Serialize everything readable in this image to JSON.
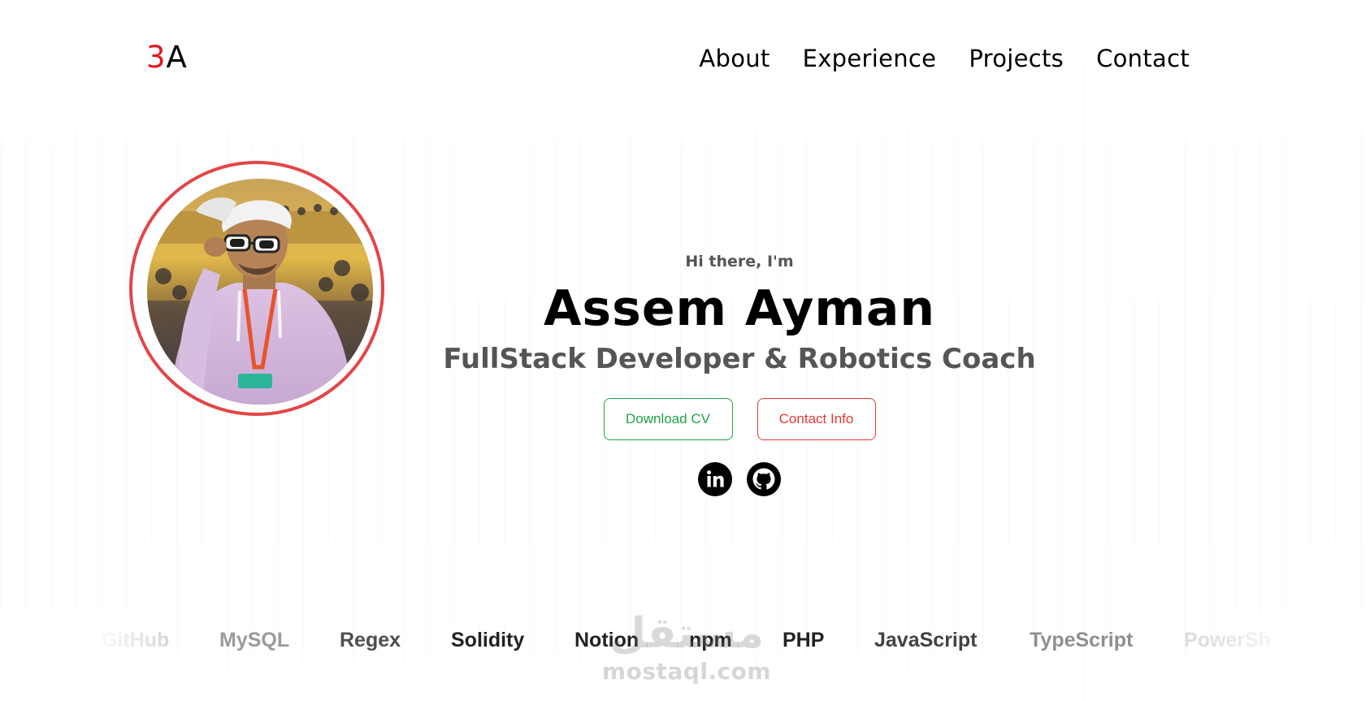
{
  "logo": {
    "accent": "3",
    "rest": "A"
  },
  "nav": {
    "items": [
      {
        "label": "About"
      },
      {
        "label": "Experience"
      },
      {
        "label": "Projects"
      },
      {
        "label": "Contact"
      }
    ]
  },
  "hero": {
    "greeting": "Hi there, I'm",
    "name": "Assem Ayman",
    "role": "FullStack Developer & Robotics Coach",
    "buttons": {
      "download_cv": "Download CV",
      "contact_info": "Contact Info"
    },
    "social": [
      {
        "icon": "linkedin-icon"
      },
      {
        "icon": "github-icon"
      }
    ]
  },
  "skills": [
    {
      "label": "GitHub",
      "opacity": 0.2
    },
    {
      "label": "MySQL",
      "opacity": 0.45
    },
    {
      "label": "Regex",
      "opacity": 0.8
    },
    {
      "label": "Solidity",
      "opacity": 1
    },
    {
      "label": "Notion",
      "opacity": 1
    },
    {
      "label": "npm",
      "opacity": 1
    },
    {
      "label": "PHP",
      "opacity": 1
    },
    {
      "label": "JavaScript",
      "opacity": 0.85
    },
    {
      "label": "TypeScript",
      "opacity": 0.5
    },
    {
      "label": "PowerSh",
      "opacity": 0.15
    }
  ],
  "watermark": {
    "arabic": "مستقل",
    "latin": "mostaql.com"
  },
  "colors": {
    "accent_red": "#e8141e",
    "ring_red": "#e44548",
    "cv_green": "#1fa348",
    "contact_red": "#e53935",
    "subtitle_gray": "#555555"
  }
}
